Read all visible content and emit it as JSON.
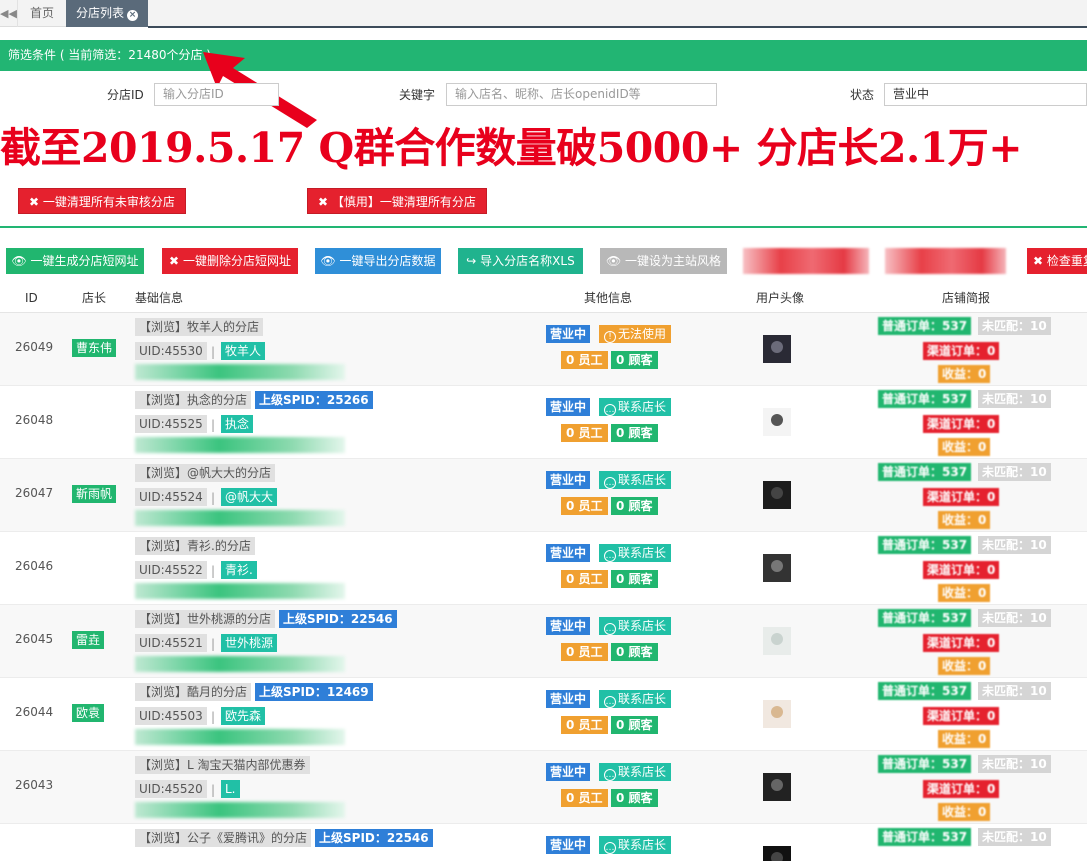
{
  "tabs": {
    "back_icon": "double-left-arrow-icon",
    "home": "首页",
    "active": "分店列表"
  },
  "filter": {
    "header": "筛选条件 ( 当前筛选：21480个分店 )",
    "shop_id_label": "分店ID",
    "shop_id_placeholder": "输入分店ID",
    "keyword_label": "关键字",
    "keyword_placeholder": "输入店名、昵称、店长openidID等",
    "status_label": "状态",
    "status_value": "营业中"
  },
  "banner": "截至2019.5.17  Q群合作数量破5000+ 分店长2.1万+",
  "danger_buttons": {
    "clear_unreviewed": "一键清理所有未审核分店",
    "clear_all": "【慎用】一键清理所有分店"
  },
  "actions": {
    "gen_short_url": "一键生成分店短网址",
    "del_short_url": "一键删除分店短网址",
    "export": "一键导出分店数据",
    "import": "导入分店名称XLS",
    "set_theme": "一键设为主站风格",
    "check_dup": "检查重复"
  },
  "columns": {
    "id": "ID",
    "owner": "店长",
    "basic": "基础信息",
    "other": "其他信息",
    "avatar": "用户头像",
    "brief": "店铺简报"
  },
  "labels": {
    "status": "营业中",
    "unusable": "无法使用",
    "contact": "联系店长",
    "staff": "0 员工",
    "customers": "0 顾客",
    "normal_order": "普通订单：537",
    "unmatched": "未匹配：10",
    "channel_order": "渠道订单：0",
    "income": "收益：0",
    "pipe": "|"
  },
  "colors": {
    "green": "#22b573",
    "red": "#e5212e",
    "blue": "#2f7fd8",
    "orange": "#f0a030",
    "teal": "#21c0a6"
  },
  "rows": [
    {
      "id": "26049",
      "owner": "曹东伟",
      "browse": "【浏览】牧羊人的分店",
      "spid": "",
      "uid": "UID:45530",
      "nick": "牧羊人",
      "contact_type": "unusable"
    },
    {
      "id": "26048",
      "owner": "",
      "browse": "【浏览】执念的分店",
      "spid": "上级SPID：25266",
      "uid": "UID:45525",
      "nick": "执念",
      "contact_type": "contact"
    },
    {
      "id": "26047",
      "owner": "靳雨帆",
      "browse": "【浏览】@帆大大的分店",
      "spid": "",
      "uid": "UID:45524",
      "nick": "@帆大大",
      "contact_type": "contact"
    },
    {
      "id": "26046",
      "owner": "",
      "browse": "【浏览】青衫.的分店",
      "spid": "",
      "uid": "UID:45522",
      "nick": "青衫.",
      "contact_type": "contact"
    },
    {
      "id": "26045",
      "owner": "雷垚",
      "browse": "【浏览】世外桃源的分店",
      "spid": "上级SPID：22546",
      "uid": "UID:45521",
      "nick": "世外桃源",
      "contact_type": "contact"
    },
    {
      "id": "26044",
      "owner": "欧袁",
      "browse": "【浏览】酷月的分店",
      "spid": "上级SPID：12469",
      "uid": "UID:45503",
      "nick": "欧先森",
      "contact_type": "contact"
    },
    {
      "id": "26043",
      "owner": "",
      "browse": "【浏览】L 淘宝天猫内部优惠券",
      "spid": "",
      "uid": "UID:45520",
      "nick": "L.",
      "contact_type": "contact"
    },
    {
      "id": "",
      "owner": "",
      "browse": "【浏览】公子《爱腾讯》的分店",
      "spid": "上级SPID：22546",
      "uid": "",
      "nick": "",
      "contact_type": "contact"
    }
  ]
}
